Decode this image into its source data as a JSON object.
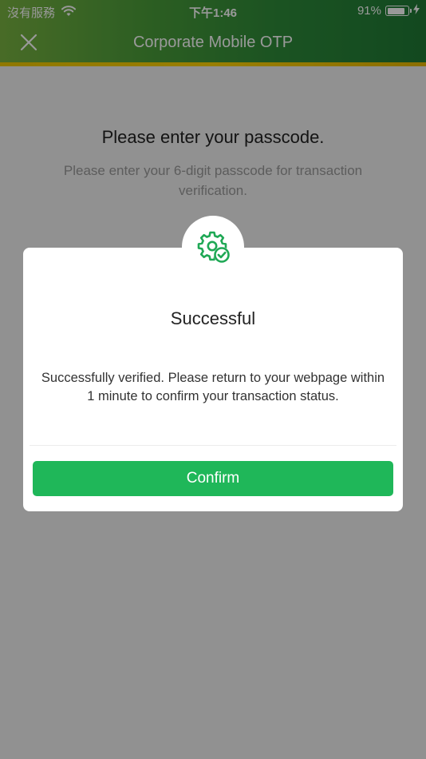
{
  "status_bar": {
    "carrier": "沒有服務",
    "time": "下午1:46",
    "battery_percent": "91%",
    "battery_level": 0.91
  },
  "nav": {
    "title": "Corporate Mobile OTP"
  },
  "page": {
    "title": "Please enter your passcode.",
    "subtitle": "Please enter your 6-digit passcode for transaction verification."
  },
  "dialog": {
    "icon": "gear-check-icon",
    "title": "Successful",
    "message": "Successfully verified. Please return to your webpage within 1 minute to confirm your transaction status.",
    "confirm_label": "Confirm"
  },
  "colors": {
    "primary_green": "#1fb759",
    "header_gold": "#ffd200",
    "overlay": "rgba(0,0,0,0.40)"
  }
}
